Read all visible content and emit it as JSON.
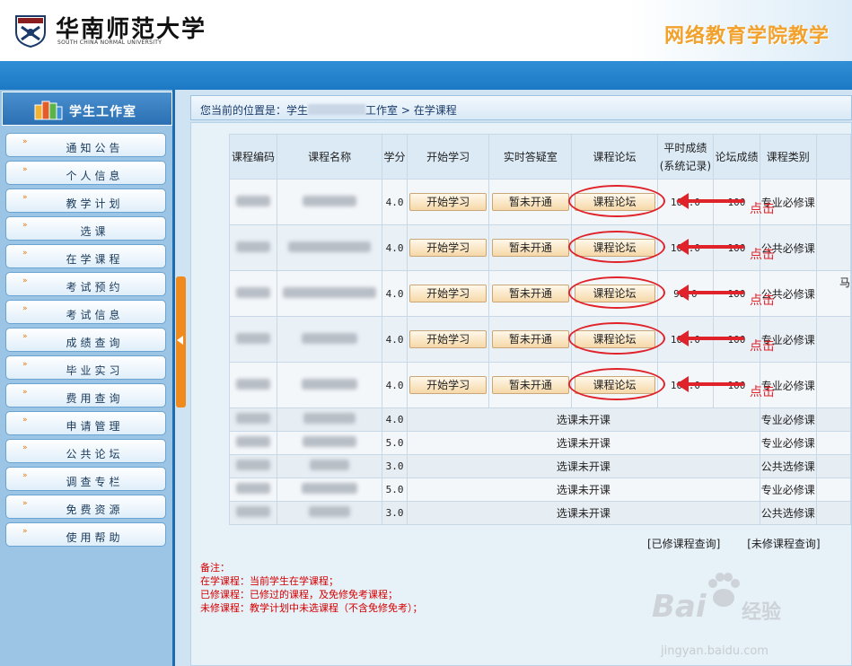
{
  "header": {
    "logo_text": "华南师范大学",
    "logo_sub": "SOUTH CHINA NORMAL UNIVERSITY",
    "banner_title": "网络教育学院教学"
  },
  "sidebar": {
    "title": "学生工作室",
    "items": [
      {
        "label": "通知公告"
      },
      {
        "label": "个人信息"
      },
      {
        "label": "教学计划"
      },
      {
        "label": "选课"
      },
      {
        "label": "在学课程"
      },
      {
        "label": "考试预约"
      },
      {
        "label": "考试信息"
      },
      {
        "label": "成绩查询"
      },
      {
        "label": "毕业实习"
      },
      {
        "label": "费用查询"
      },
      {
        "label": "申请管理"
      },
      {
        "label": "公共论坛"
      },
      {
        "label": "调查专栏"
      },
      {
        "label": "免费资源"
      },
      {
        "label": "使用帮助"
      }
    ]
  },
  "breadcrumb": {
    "prefix": "您当前的位置是：学生",
    "suffix": "工作室 > 在学课程"
  },
  "table": {
    "headers": {
      "code": "课程编码",
      "name": "课程名称",
      "credit": "学分",
      "start": "开始学习",
      "qa": "实时答疑室",
      "forum": "课程论坛",
      "usual_score_1": "平时成绩",
      "usual_score_2": "(系统记录)",
      "forum_score": "论坛成绩",
      "category": "课程类别"
    },
    "active_rows": [
      {
        "credit": "4.0",
        "start": "开始学习",
        "qa": "暂未开通",
        "forum": "课程论坛",
        "usual": "100.0",
        "forum_score": "100",
        "category": "专业必修课"
      },
      {
        "credit": "4.0",
        "start": "开始学习",
        "qa": "暂未开通",
        "forum": "课程论坛",
        "usual": "100.0",
        "forum_score": "100",
        "category": "公共必修课"
      },
      {
        "credit": "4.0",
        "start": "开始学习",
        "qa": "暂未开通",
        "forum": "课程论坛",
        "usual": "98.0",
        "forum_score": "100",
        "category": "公共必修课"
      },
      {
        "credit": "4.0",
        "start": "开始学习",
        "qa": "暂未开通",
        "forum": "课程论坛",
        "usual": "100.0",
        "forum_score": "100",
        "category": "专业必修课"
      },
      {
        "credit": "4.0",
        "start": "开始学习",
        "qa": "暂未开通",
        "forum": "课程论坛",
        "usual": "100.0",
        "forum_score": "100",
        "category": "专业必修课"
      }
    ],
    "pending_rows": [
      {
        "credit": "4.0",
        "status": "选课未开课",
        "category": "专业必修课"
      },
      {
        "credit": "5.0",
        "status": "选课未开课",
        "category": "专业必修课"
      },
      {
        "credit": "3.0",
        "status": "选课未开课",
        "category": "公共选修课"
      },
      {
        "credit": "5.0",
        "status": "选课未开课",
        "category": "专业必修课"
      },
      {
        "credit": "3.0",
        "status": "选课未开课",
        "category": "公共选修课"
      }
    ],
    "overflow_char": "马"
  },
  "annotation": {
    "click_label": "点击",
    "color": "#e0232a"
  },
  "links": {
    "completed": "[已修课程查询]",
    "not_taken": "[未修课程查询]"
  },
  "notes": {
    "title": "备注：",
    "line1": "在学课程：当前学生在学课程；",
    "line2": "已修课程：已修过的课程，及免修免考课程；",
    "line3": "未修课程：教学计划中未选课程（不含免修免考）；"
  },
  "watermark": {
    "brand": "Bai",
    "suffix": "经验",
    "url": "jingyan.baidu.com"
  }
}
